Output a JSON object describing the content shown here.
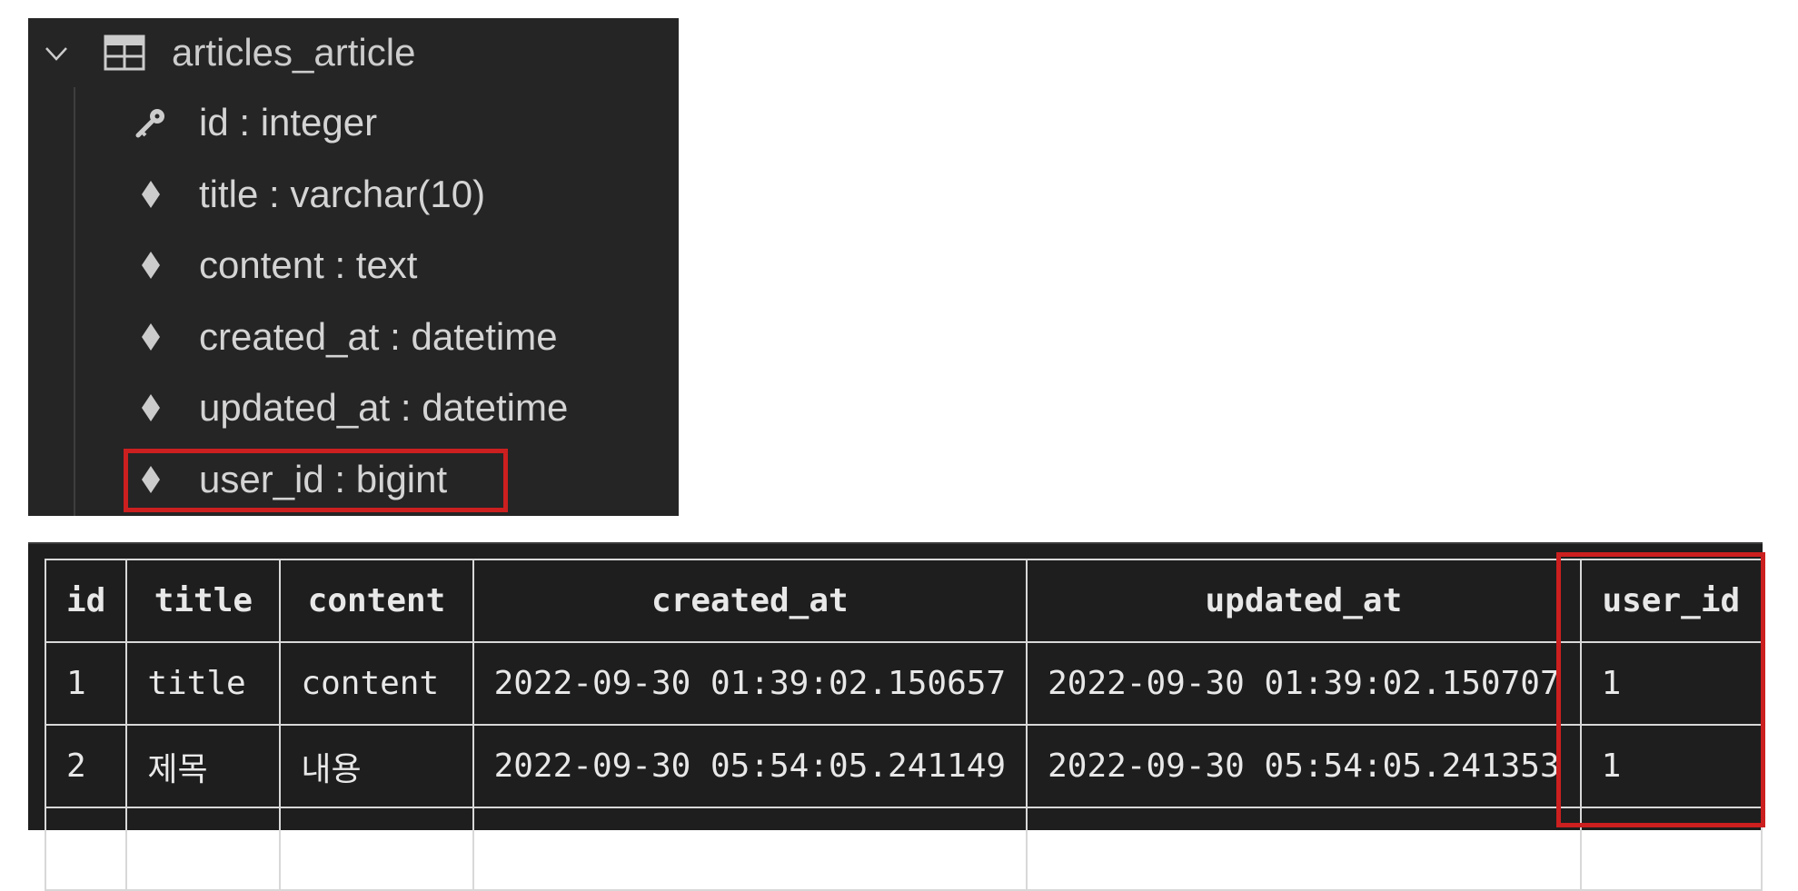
{
  "schema_tree": {
    "table_name": "articles_article",
    "columns": [
      {
        "label": "id : integer",
        "icon": "key-icon"
      },
      {
        "label": "title : varchar(10)",
        "icon": "diamond-icon"
      },
      {
        "label": "content : text",
        "icon": "diamond-icon"
      },
      {
        "label": "created_at : datetime",
        "icon": "diamond-icon"
      },
      {
        "label": "updated_at : datetime",
        "icon": "diamond-icon"
      },
      {
        "label": "user_id : bigint",
        "icon": "diamond-icon"
      }
    ]
  },
  "results_table": {
    "headers": [
      "id",
      "title",
      "content",
      "created_at",
      "updated_at",
      "user_id"
    ],
    "rows": [
      [
        "1",
        "title",
        "content",
        "2022-09-30 01:39:02.150657",
        "2022-09-30 01:39:02.150707",
        "1"
      ],
      [
        "2",
        "제목",
        "내용",
        "2022-09-30 05:54:05.241149",
        "2022-09-30 05:54:05.241353",
        "1"
      ]
    ]
  },
  "colors": {
    "panel_bg": "#252526",
    "table_bg": "#1e1e1e",
    "highlight": "#cc1f1f"
  }
}
